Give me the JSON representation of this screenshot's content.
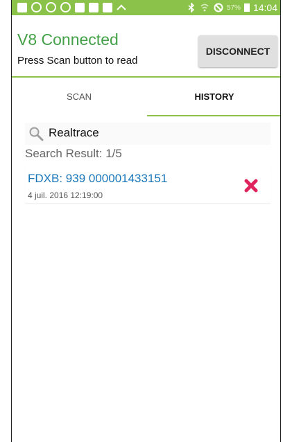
{
  "status_bar": {
    "battery_percent": "57%",
    "time": "14:04"
  },
  "header": {
    "title": "V8 Connected",
    "subtitle": "Press Scan button to read",
    "disconnect_label": "DISCONNECT"
  },
  "tabs": [
    {
      "label": "SCAN",
      "active": false
    },
    {
      "label": "HISTORY",
      "active": true
    }
  ],
  "search": {
    "value": "Realtrace",
    "result_text": "Search Result: 1/5"
  },
  "records": [
    {
      "id": "FDXB: 939 000001433151",
      "date": "4 juil. 2016 12:19:00"
    }
  ],
  "colors": {
    "accent": "#8bc34a",
    "title": "#43a047",
    "record_id": "#1976b8",
    "delete": "#e0245e"
  }
}
